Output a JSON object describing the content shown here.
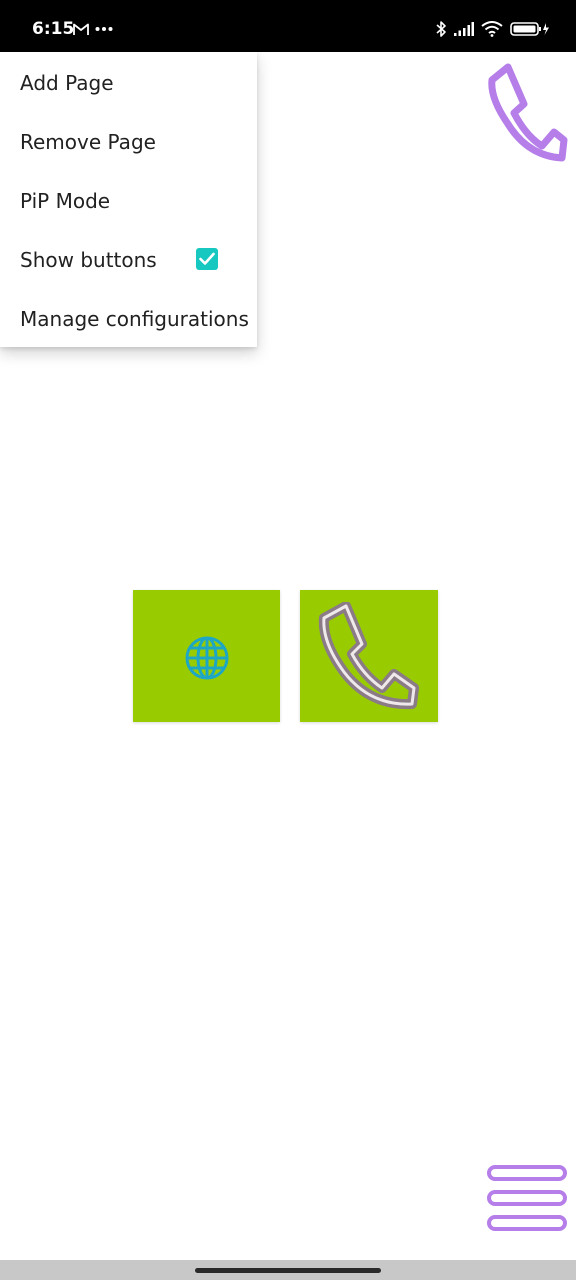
{
  "status_bar": {
    "time": "6:15",
    "icons_left": [
      "gmail-icon",
      "more-dots-icon"
    ],
    "icons_right": [
      "bluetooth-icon",
      "signal-icon",
      "wifi-icon",
      "battery-charging-icon"
    ]
  },
  "menu": {
    "items": [
      {
        "label": "Add Page"
      },
      {
        "label": "Remove Page"
      },
      {
        "label": "PiP Mode"
      },
      {
        "label": "Show buttons",
        "checked": true
      },
      {
        "label": "Manage configurations"
      }
    ]
  },
  "tiles": [
    {
      "icon": "globe-icon"
    },
    {
      "icon": "phone-icon"
    }
  ],
  "colors": {
    "tile_background": "#99cc00",
    "accent_purple": "#b57ee8",
    "checkbox": "#17c8c0",
    "globe": "#1ea7c4",
    "phone_tile_icon": "#8a7b86"
  }
}
